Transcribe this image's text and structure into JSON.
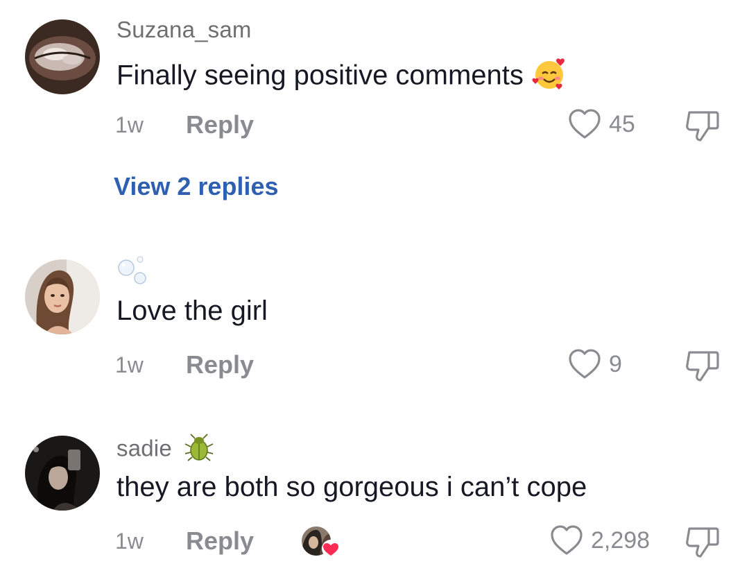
{
  "comments": [
    {
      "username": "Suzana_sam",
      "text": "Finally seeing positive comments",
      "emoji": "smiling-face-with-hearts",
      "time": "1w",
      "reply_label": "Reply",
      "likes": "45",
      "view_replies": "View 2 replies"
    },
    {
      "username": "",
      "username_emoji": "bubbles",
      "text": "Love the girl",
      "time": "1w",
      "reply_label": "Reply",
      "likes": "9"
    },
    {
      "username": "sadie",
      "username_emoji": "beetle",
      "text": "they are both so gorgeous i can’t cope",
      "time": "1w",
      "reply_label": "Reply",
      "likes": "2,298",
      "creator_liked": true
    }
  ],
  "colors": {
    "text_primary": "#161823",
    "text_secondary": "#8a8b91",
    "link_blue": "#2f5fb0",
    "heart_red": "#fe2c55"
  }
}
